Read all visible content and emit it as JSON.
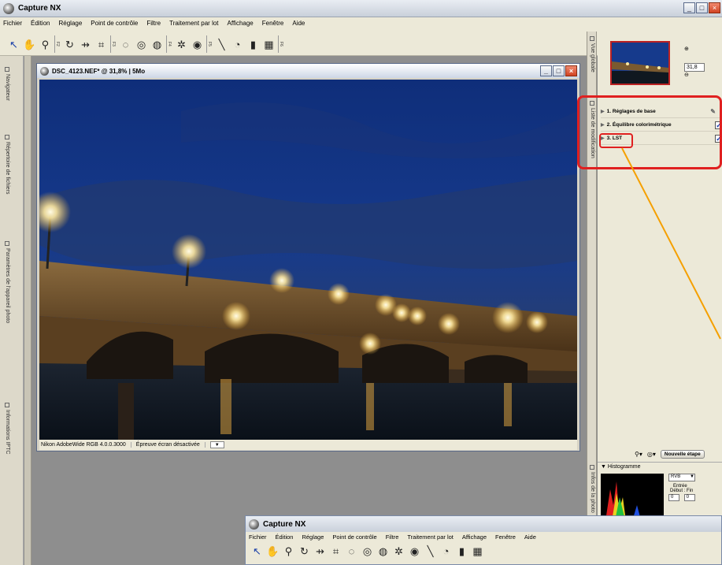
{
  "app": {
    "title": "Capture NX"
  },
  "menu": [
    "Fichier",
    "Édition",
    "Réglage",
    "Point de contrôle",
    "Filtre",
    "Traitement par lot",
    "Affichage",
    "Fenêtre",
    "Aide"
  ],
  "toolbar": {
    "icons": [
      "select-arrow-icon",
      "hand-icon",
      "zoom-icon",
      "rotate-icon",
      "straighten-icon",
      "crop-icon",
      "selection-brush-icon",
      "lasso-icon",
      "marquee-icon",
      "black-point-icon",
      "white-point-icon",
      "red-eye-icon",
      "line-icon",
      "gradient-icon",
      "fill-icon",
      "brush-icon"
    ],
    "fkeys": [
      "F2",
      "F3",
      "F4",
      "F5",
      "F6"
    ]
  },
  "left_tabs": [
    "Navigateur",
    "Répertoire de fichiers",
    "Paramètres de l'appareil photo",
    "Informations IPTC"
  ],
  "image_window": {
    "title": "DSC_4123.NEF* @ 31,8% | 5Mo",
    "status_profile": "Nikon AdobeWide RGB 4.0.0.3000",
    "status_proof": "Épreuve écran désactivée"
  },
  "right_tabs": [
    "Vue globale",
    "Liste de modification",
    "Infos de la photo"
  ],
  "navigator": {
    "zoom": "31,8"
  },
  "edit_list": {
    "steps": [
      {
        "label": "1. Réglages de base",
        "checked": true
      },
      {
        "label": "2. Équilibre colorimétrique",
        "checked": true
      },
      {
        "label": "3. LST",
        "checked": true
      }
    ],
    "new_step_label": "Nouvelle étape"
  },
  "histogram": {
    "title": "Histogramme",
    "channel": "RVB",
    "input_label": "Entrée",
    "range_label": "Début : Fin",
    "start": "0",
    "end": "0"
  },
  "second_window": {
    "title": "Capture NX",
    "menu": [
      "Fichier",
      "Édition",
      "Réglage",
      "Point de contrôle",
      "Filtre",
      "Traitement par lot",
      "Affichage",
      "Fenêtre",
      "Aide"
    ]
  },
  "colors": {
    "highlight": "#e02020",
    "arrow": "#f5a000",
    "accent": "#1a3fa8"
  }
}
